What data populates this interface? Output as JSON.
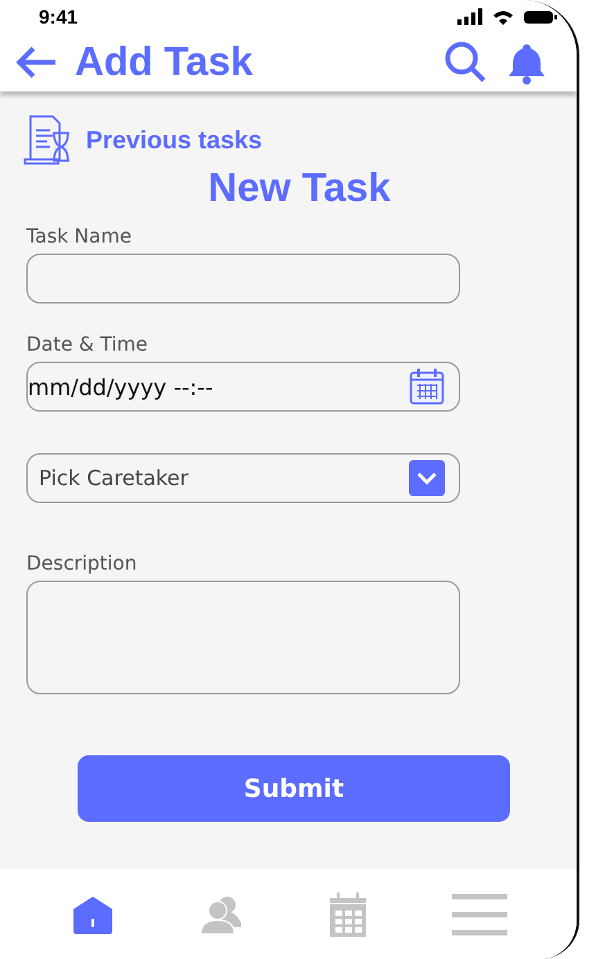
{
  "status_bar": {
    "time": "9:41"
  },
  "header": {
    "title": "Add Task"
  },
  "previous_tasks": {
    "label": "Previous tasks"
  },
  "form": {
    "title": "New Task",
    "fields": [
      {
        "kind": "text",
        "label": "Task Name"
      },
      {
        "kind": "datetime",
        "label": "Date & Time",
        "value": "mm/dd/yyyy --:--"
      },
      {
        "kind": "select",
        "value": "Pick Caretaker"
      },
      {
        "kind": "textarea",
        "label": "Description"
      }
    ],
    "submit": "Submit"
  },
  "nav": [
    {
      "kind": "home",
      "selected": true
    },
    {
      "kind": "people",
      "selected": false
    },
    {
      "kind": "calendar",
      "selected": false
    },
    {
      "kind": "menu",
      "selected": false
    }
  ]
}
